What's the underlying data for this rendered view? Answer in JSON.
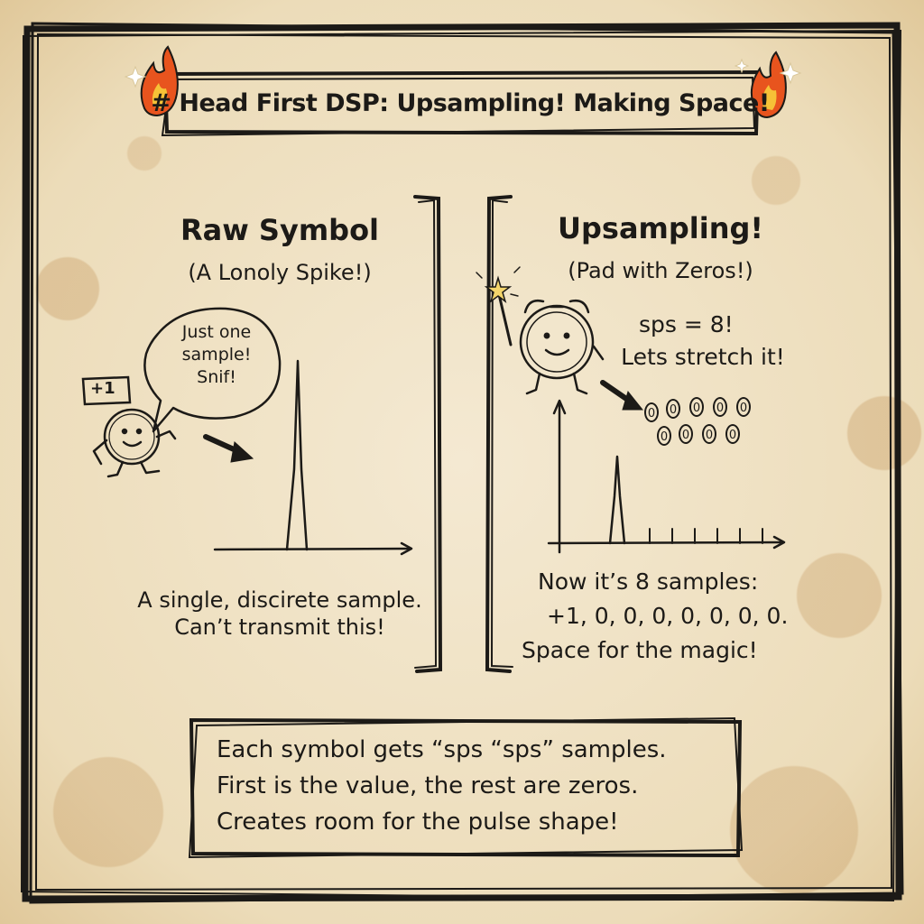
{
  "title": "# Head First DSP: Upsampling! Making Space!",
  "left_panel": {
    "heading": "Raw Symbol",
    "subheading": "(A Lonoly Spike!)",
    "bubble_lines": [
      "Just one",
      "sample!",
      "Snif!"
    ],
    "badge": "+1",
    "caption_lines": [
      "A single, discirete sample.",
      "Can’t transmit this!"
    ]
  },
  "right_panel": {
    "heading": "Upsampling!",
    "subheading": "(Pad with Zeros!)",
    "note_lines": [
      "sps = 8!",
      "Lets stretch it!"
    ],
    "zero_glyph": "0",
    "caption_lines": [
      "Now it’s 8 samples:",
      "+1, 0, 0, 0, 0, 0, 0, 0.",
      "Space for the magic!"
    ]
  },
  "bottom_note": {
    "lines": [
      "Each symbol gets “sps “sps” samples.",
      "First is the value, the rest are zeros.",
      "Creates room for the pulse shape!"
    ]
  },
  "icons": [
    "flame-icon",
    "sparkle-icon",
    "magic-wand-icon",
    "arrow-icon",
    "coin-character-icon",
    "alarm-clock-character-icon"
  ],
  "colors": {
    "ink": "#1c1a17",
    "paper": "#efe2c4",
    "stain": "#c4965c",
    "flame": "#e8541e"
  }
}
